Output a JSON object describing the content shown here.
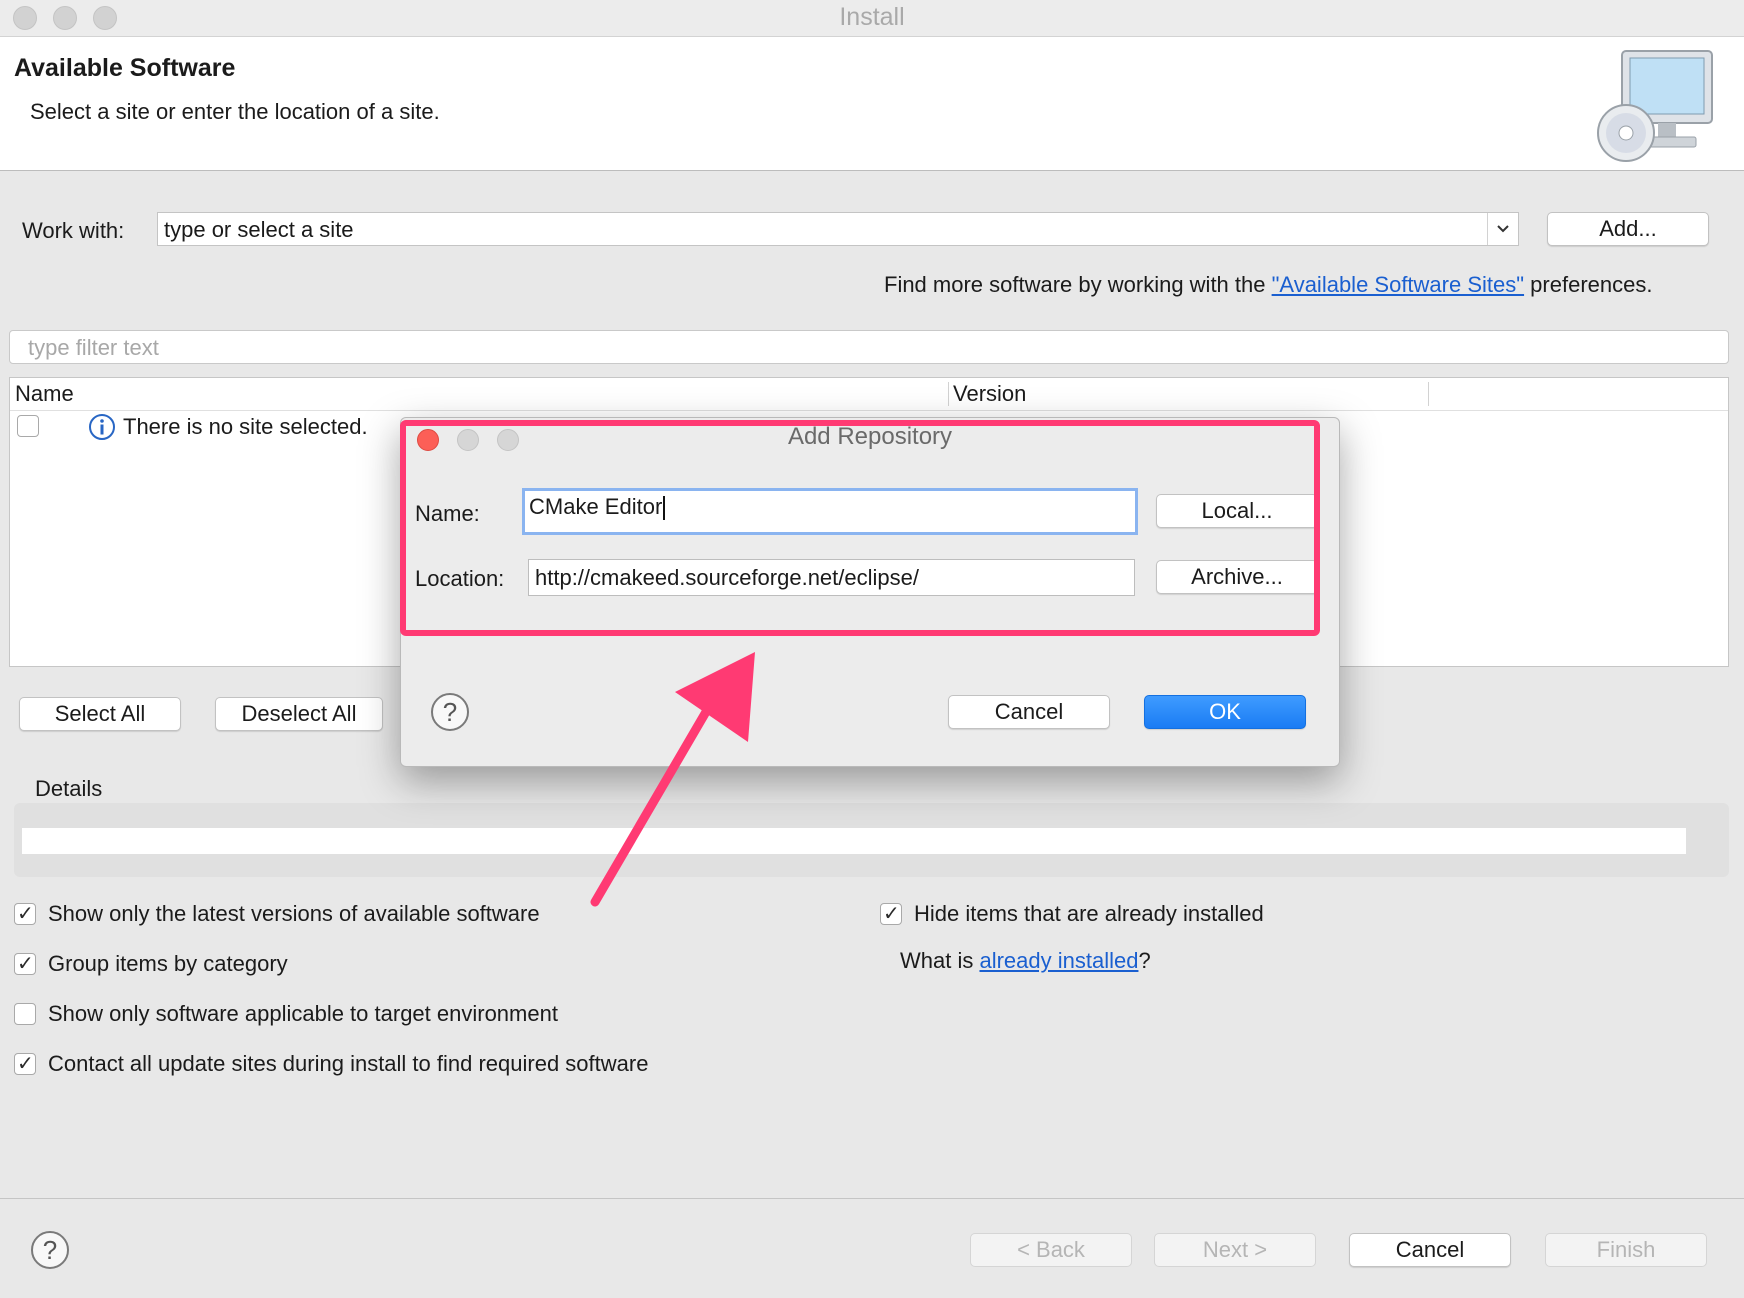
{
  "window": {
    "title": "Install"
  },
  "header": {
    "title": "Available Software",
    "subtitle": "Select a site or enter the location of a site."
  },
  "work_with": {
    "label": "Work with:",
    "value": "type or select a site",
    "add_label": "Add..."
  },
  "find_more": {
    "prefix": "Find more software by working with the ",
    "link": "\"Available Software Sites\"",
    "suffix": " preferences."
  },
  "filter": {
    "placeholder": "type filter text"
  },
  "table": {
    "columns": [
      "Name",
      "Version"
    ],
    "empty_message": "There is no site selected."
  },
  "buttons": {
    "select_all": "Select All",
    "deselect_all": "Deselect All",
    "back": "< Back",
    "next": "Next >",
    "cancel": "Cancel",
    "finish": "Finish"
  },
  "details": {
    "label": "Details"
  },
  "options": {
    "latest_versions": {
      "label": "Show only the latest versions of available software",
      "checked": true
    },
    "group_by_category": {
      "label": "Group items by category",
      "checked": true
    },
    "applicable_target": {
      "label": "Show only software applicable to target environment",
      "checked": false
    },
    "contact_update_sites": {
      "label": "Contact all update sites during install to find required software",
      "checked": true
    },
    "hide_installed": {
      "label": "Hide items that are already installed",
      "checked": true
    }
  },
  "already_installed": {
    "prefix": "What is ",
    "link": "already installed",
    "suffix": "?"
  },
  "dialog": {
    "title": "Add Repository",
    "name_label": "Name:",
    "name_value": "CMake Editor",
    "location_label": "Location:",
    "location_value": "http://cmakeed.sourceforge.net/eclipse/",
    "local_label": "Local...",
    "archive_label": "Archive...",
    "cancel_label": "Cancel",
    "ok_label": "OK"
  },
  "colors": {
    "highlight": "#ff3a73",
    "primary_button": "#1a7cf4",
    "link": "#1a5fd0"
  }
}
